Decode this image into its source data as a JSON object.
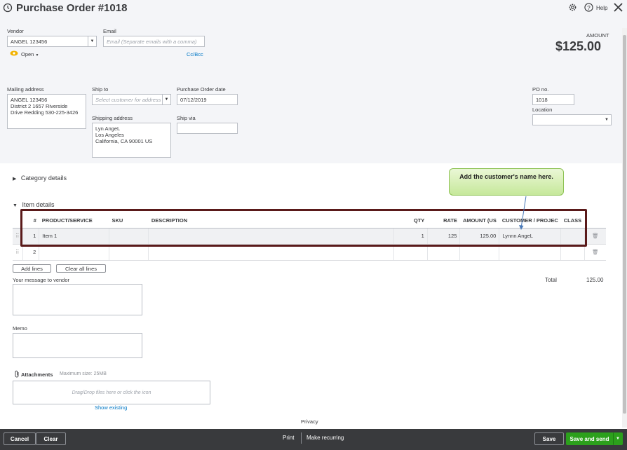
{
  "header": {
    "title": "Purchase Order #1018",
    "help_label": "Help",
    "amount_label": "AMOUNT",
    "amount_value": "$125.00"
  },
  "vendor": {
    "label": "Vendor",
    "value": "ANGEL 123456",
    "status": "Open"
  },
  "email": {
    "label": "Email",
    "placeholder": "Email (Separate emails with a comma)",
    "cc_bcc": "Cc/Bcc"
  },
  "mailing": {
    "label": "Mailing address",
    "value": "ANGEL 123456\nDistrict 2 1657 Riverside\nDrive Redding 530-225-3426"
  },
  "ship_to": {
    "label": "Ship to",
    "placeholder": "Select customer for address"
  },
  "shipping": {
    "label": "Shipping address",
    "value": "Lyn AngeL\nLos Angeles\nCalifornia, CA 90001 US"
  },
  "po_date": {
    "label": "Purchase Order date",
    "value": "07/12/2019"
  },
  "ship_via": {
    "label": "Ship via",
    "value": ""
  },
  "po_no": {
    "label": "PO no.",
    "value": "1018"
  },
  "location": {
    "label": "Location",
    "value": ""
  },
  "sections": {
    "category": "Category details",
    "item": "Item details"
  },
  "table": {
    "columns": [
      "#",
      "PRODUCT/SERVICE",
      "SKU",
      "DESCRIPTION",
      "QTY",
      "RATE",
      "AMOUNT (US",
      "CUSTOMER / PROJEC",
      "CLASS"
    ],
    "rows": [
      {
        "num": "1",
        "product": "Item 1",
        "sku": "",
        "description": "",
        "qty": "1",
        "rate": "125",
        "amount": "125.00",
        "customer": "Lynnn AngeL",
        "class": ""
      },
      {
        "num": "2",
        "product": "",
        "sku": "",
        "description": "",
        "qty": "",
        "rate": "",
        "amount": "",
        "customer": "",
        "class": ""
      }
    ]
  },
  "buttons": {
    "add_lines": "Add lines",
    "clear_all_lines": "Clear all lines"
  },
  "total": {
    "label": "Total",
    "value": "125.00"
  },
  "message": {
    "label": "Your message to vendor"
  },
  "memo": {
    "label": "Memo"
  },
  "attachments": {
    "label": "Attachments",
    "max_size": "Maximum size: 25MB",
    "drop_text": "Drag/Drop files here or click the icon",
    "show_existing": "Show existing"
  },
  "privacy": "Privacy",
  "callout": "Add the customer's name here.",
  "footer": {
    "cancel": "Cancel",
    "clear": "Clear",
    "print": "Print",
    "make_recurring": "Make recurring",
    "save": "Save",
    "save_and_send": "Save and send"
  },
  "colors": {
    "accent_green": "#2ca01c",
    "link_blue": "#0077c5",
    "footer_bg": "#393a3d",
    "header_bg": "#f4f5f8",
    "open_status": "#f2b200"
  }
}
